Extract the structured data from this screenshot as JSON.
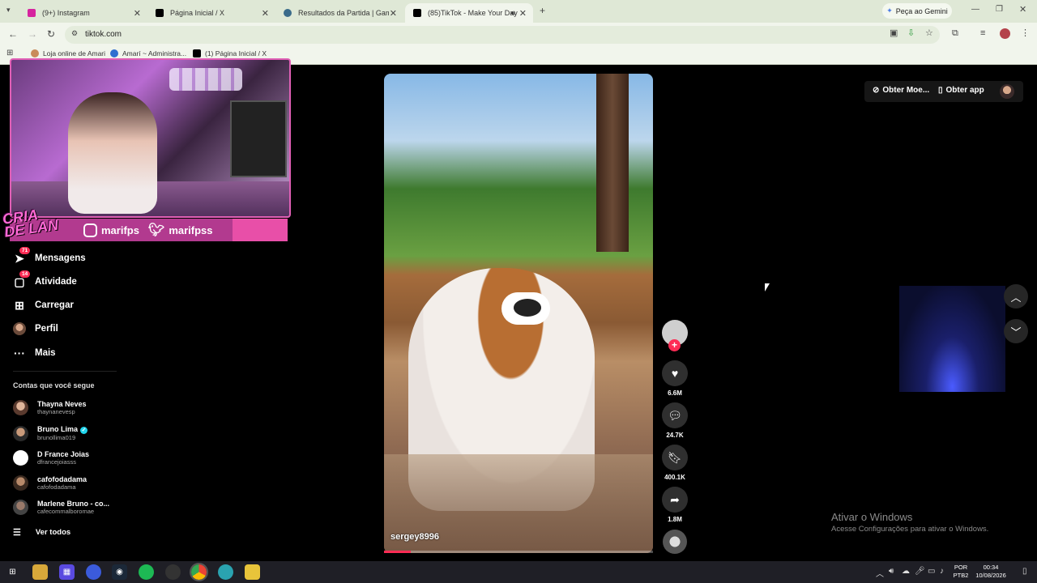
{
  "browser": {
    "tabs": [
      {
        "title": "(9+) Instagram",
        "color": "#d6249f"
      },
      {
        "title": "Página Inicial / X",
        "color": "#000000"
      },
      {
        "title": "Resultados da Partida | Gamers",
        "color": "#3a6b8a"
      },
      {
        "title": "(85)TikTok - Make Your Day",
        "color": "#000000"
      }
    ],
    "new_tab": "+",
    "gemini": "Peça ao Gemini",
    "url": "tiktok.com",
    "bookmarks": [
      "Loja online de Amari",
      "Amarí ~ Administra...",
      "(1) Página Inicial / X"
    ]
  },
  "stream_overlay": {
    "instagram_handle": "marifps",
    "twitter_handle": "marifpss",
    "logo_text": "CRIA DE LAN"
  },
  "sidebar": {
    "nav": [
      {
        "label": "Mensagens",
        "icon": "send-icon",
        "badge": "71"
      },
      {
        "label": "Atividade",
        "icon": "inbox-icon",
        "badge": "14"
      },
      {
        "label": "Carregar",
        "icon": "upload-icon",
        "badge": ""
      },
      {
        "label": "Perfil",
        "icon": "profile-icon",
        "badge": ""
      },
      {
        "label": "Mais",
        "icon": "more-icon",
        "badge": ""
      }
    ],
    "following_title": "Contas que você segue",
    "following": [
      {
        "name": "Thayna Neves",
        "handle": "thaynanevesp",
        "verified": false
      },
      {
        "name": "Bruno Lima",
        "handle": "brunollima019",
        "verified": true
      },
      {
        "name": "D France Joias",
        "handle": "dfrancejoiasss",
        "verified": false
      },
      {
        "name": "cafofodadama",
        "handle": "cafofodadama",
        "verified": false
      },
      {
        "name": "Marlene Bruno - co...",
        "handle": "cafecommalboromae",
        "verified": false
      }
    ],
    "see_all": "Ver todos"
  },
  "video": {
    "author": "sergey8996",
    "progress": 0.1,
    "likes": "6.6M",
    "comments": "24.7K",
    "saves": "400.1K",
    "shares": "1.8M"
  },
  "topright": {
    "coins": "Obter Moe...",
    "get_app": "Obter app"
  },
  "windows": {
    "watermark_title": "Ativar o Windows",
    "watermark_sub": "Acesse Configurações para ativar o Windows.",
    "lang_line1": "POR",
    "lang_line2": "PTB2",
    "time": "00:34",
    "date": "10/08/2026"
  }
}
